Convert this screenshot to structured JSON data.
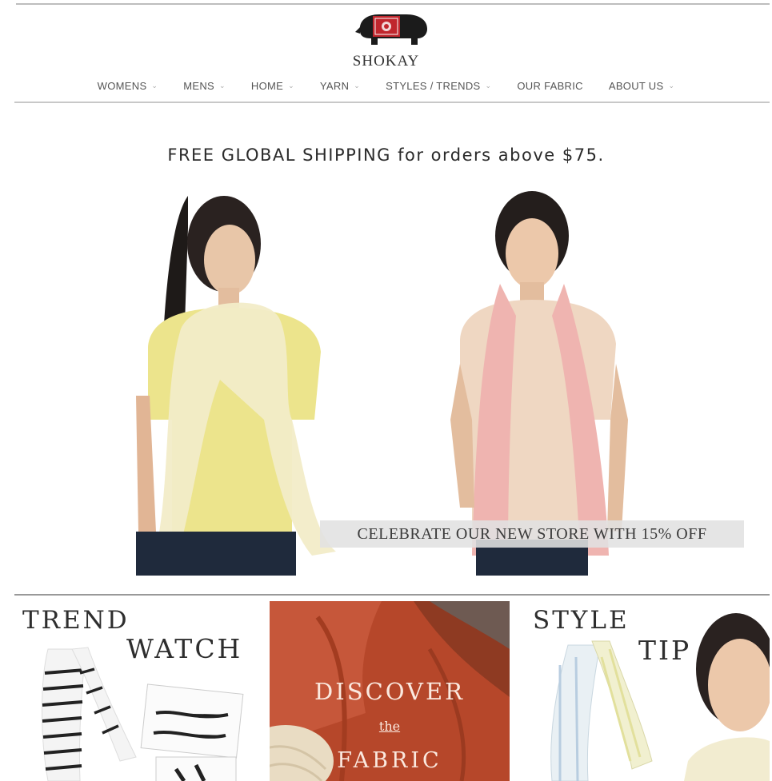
{
  "brand": {
    "name": "SHOKAY",
    "logo_icon": "yak-logo-icon"
  },
  "nav": {
    "items": [
      {
        "label": "WOMENS",
        "dropdown": true
      },
      {
        "label": "MENS",
        "dropdown": true
      },
      {
        "label": "HOME",
        "dropdown": true
      },
      {
        "label": "YARN",
        "dropdown": true
      },
      {
        "label": "STYLES / TRENDS",
        "dropdown": true
      },
      {
        "label": "OUR FABRIC",
        "dropdown": false
      },
      {
        "label": "ABOUT US",
        "dropdown": true
      }
    ],
    "chevron": "⌄"
  },
  "promo": {
    "shipping": "FREE GLOBAL SHIPPING for orders above $75."
  },
  "hero": {
    "banner": "CELEBRATE OUR NEW STORE WITH 15% OFF"
  },
  "panels": {
    "trend": {
      "title_1": "TREND",
      "title_2": "WATCH"
    },
    "discover": {
      "line_1": "DISCOVER",
      "line_2": "the",
      "line_3": "FABRIC"
    },
    "style": {
      "title_1": "STYLE",
      "title_2": "TIP"
    }
  },
  "colors": {
    "discover_panel": "#b94a2b",
    "logo_red": "#c0262d",
    "yellow_top": "#efe58a",
    "pink_scarf": "#efb4b0"
  }
}
